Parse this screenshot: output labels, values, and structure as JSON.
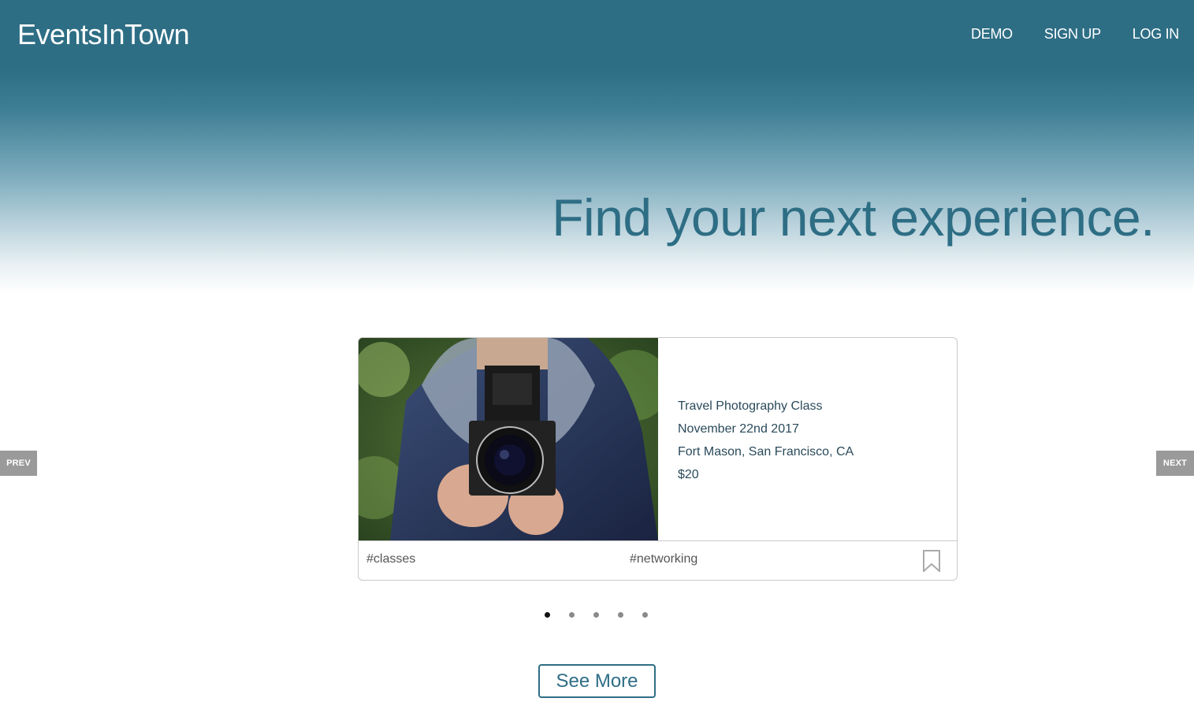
{
  "header": {
    "logo": "EventsInTown",
    "nav": [
      {
        "label": "DEMO"
      },
      {
        "label": "SIGN UP"
      },
      {
        "label": "LOG IN"
      }
    ]
  },
  "hero": {
    "headline": "Find your next experience."
  },
  "carousel": {
    "prev_label": "PREV",
    "next_label": "NEXT",
    "active_index": 0,
    "slide_count": 5,
    "event": {
      "image_icon": "camera-photo",
      "title": "Travel Photography Class",
      "date": "November 22nd 2017",
      "location": "Fort Mason, San Francisco, CA",
      "price": "$20",
      "tags": [
        "#classes",
        "#networking"
      ],
      "bookmark_icon": "bookmark-icon"
    }
  },
  "actions": {
    "see_more_label": "See More"
  },
  "colors": {
    "brand": "#2e6e85",
    "nav_button": "#9a9a9a"
  }
}
